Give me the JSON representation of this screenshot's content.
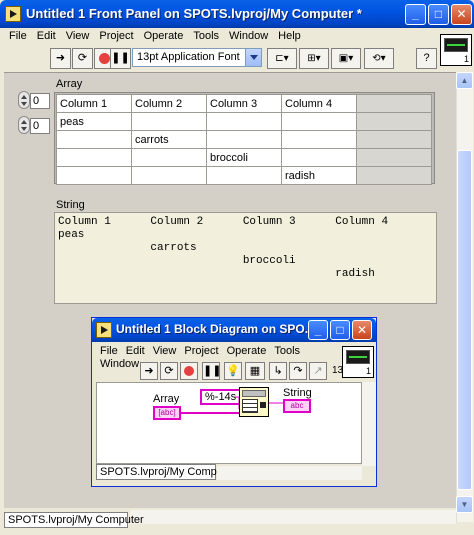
{
  "window": {
    "title": "Untitled 1 Front Panel on SPOTS.lvproj/My Computer *",
    "minimize": "_",
    "maximize": "□",
    "close": "✕"
  },
  "menu": [
    "File",
    "Edit",
    "View",
    "Project",
    "Operate",
    "Tools",
    "Window",
    "Help"
  ],
  "toolbar": {
    "font": "13pt Application Font",
    "help": "?"
  },
  "vi_icon_number": "1",
  "front_panel": {
    "array": {
      "label": "Array",
      "row_index": "0",
      "col_index": "0",
      "rows": [
        [
          "Column 1",
          "Column 2",
          "Column 3",
          "Column 4"
        ],
        [
          "peas",
          "",
          "",
          ""
        ],
        [
          "",
          "carrots",
          "",
          ""
        ],
        [
          "",
          "",
          "broccoli",
          ""
        ],
        [
          "",
          "",
          "",
          "radish"
        ]
      ]
    },
    "string": {
      "label": "String",
      "lines": [
        "Column 1      Column 2      Column 3      Column 4",
        "peas",
        "              carrots",
        "                            broccoli",
        "                                          radish"
      ]
    }
  },
  "status": "SPOTS.lvproj/My Computer",
  "block_diagram": {
    "title": "Untitled 1 Block Diagram on SPO...",
    "menu": [
      "File",
      "Edit",
      "View",
      "Project",
      "Operate",
      "Tools",
      "Window"
    ],
    "array_label": "Array",
    "string_label": "String",
    "format_constant": "%-14s",
    "array_terminal": "[abc]",
    "string_terminal": "abc",
    "toolbar_font": "13",
    "status": "SPOTS.lvproj/My Computer",
    "vi_icon_number": "1"
  },
  "colors": {
    "title_blue": "#0054e3",
    "string_pink": "#e000c8",
    "panel_gray": "#d4d0c8"
  }
}
